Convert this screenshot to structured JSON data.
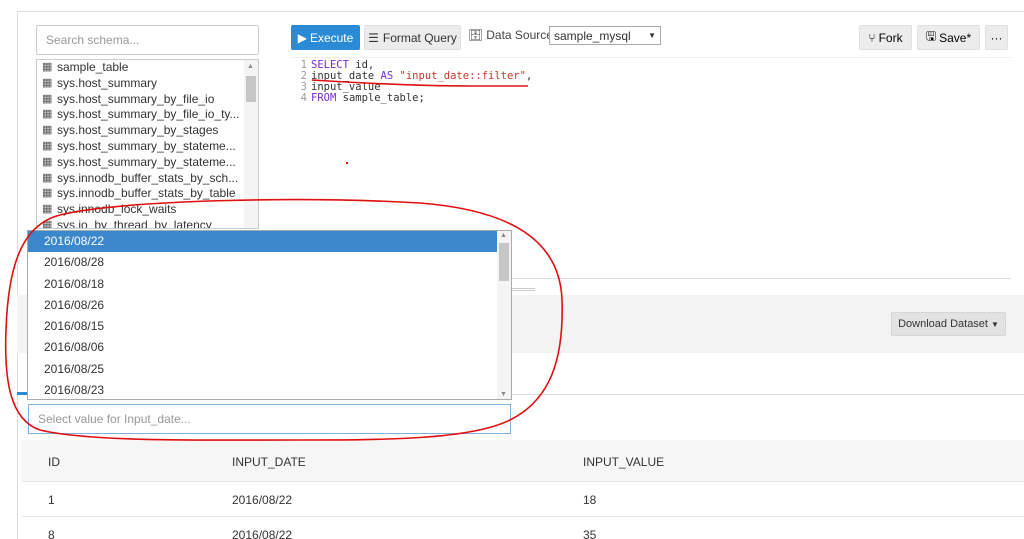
{
  "schema": {
    "search_placeholder": "Search schema...",
    "items": [
      "sample_table",
      "sys.host_summary",
      "sys.host_summary_by_file_io",
      "sys.host_summary_by_file_io_ty...",
      "sys.host_summary_by_stages",
      "sys.host_summary_by_stateme...",
      "sys.host_summary_by_stateme...",
      "sys.innodb_buffer_stats_by_sch...",
      "sys.innodb_buffer_stats_by_table",
      "sys.innodb_lock_waits",
      "sys.io_by_thread_by_latency"
    ],
    "item_icon": "table-icon"
  },
  "toolbar": {
    "execute_label": "Execute",
    "format_label": "Format Query",
    "datasource_label": "Data Source",
    "datasource_value": "sample_mysql",
    "fork_label": "Fork",
    "save_label": "Save*",
    "more_label": "···"
  },
  "editor": {
    "lines": [
      {
        "num": "1",
        "code": "SELECT id,"
      },
      {
        "num": "2",
        "code": "input_date AS \"input_date::filter\","
      },
      {
        "num": "3",
        "code": "input_value"
      },
      {
        "num": "4",
        "code": "FROM sample_table;"
      }
    ]
  },
  "dropdown": {
    "options": [
      "2016/08/22",
      "2016/08/28",
      "2016/08/18",
      "2016/08/26",
      "2016/08/15",
      "2016/08/06",
      "2016/08/25",
      "2016/08/23"
    ],
    "selected_index": 0
  },
  "filter": {
    "placeholder": "Select value for Input_date..."
  },
  "results": {
    "download_label": "Download Dataset",
    "columns": [
      "ID",
      "INPUT_DATE",
      "INPUT_VALUE"
    ],
    "rows": [
      [
        "1",
        "2016/08/22",
        "18"
      ],
      [
        "8",
        "2016/08/22",
        "35"
      ]
    ]
  },
  "colors": {
    "accent": "#2b8ad6",
    "selected_row": "#3b87cb",
    "annotation": "#e01010"
  }
}
